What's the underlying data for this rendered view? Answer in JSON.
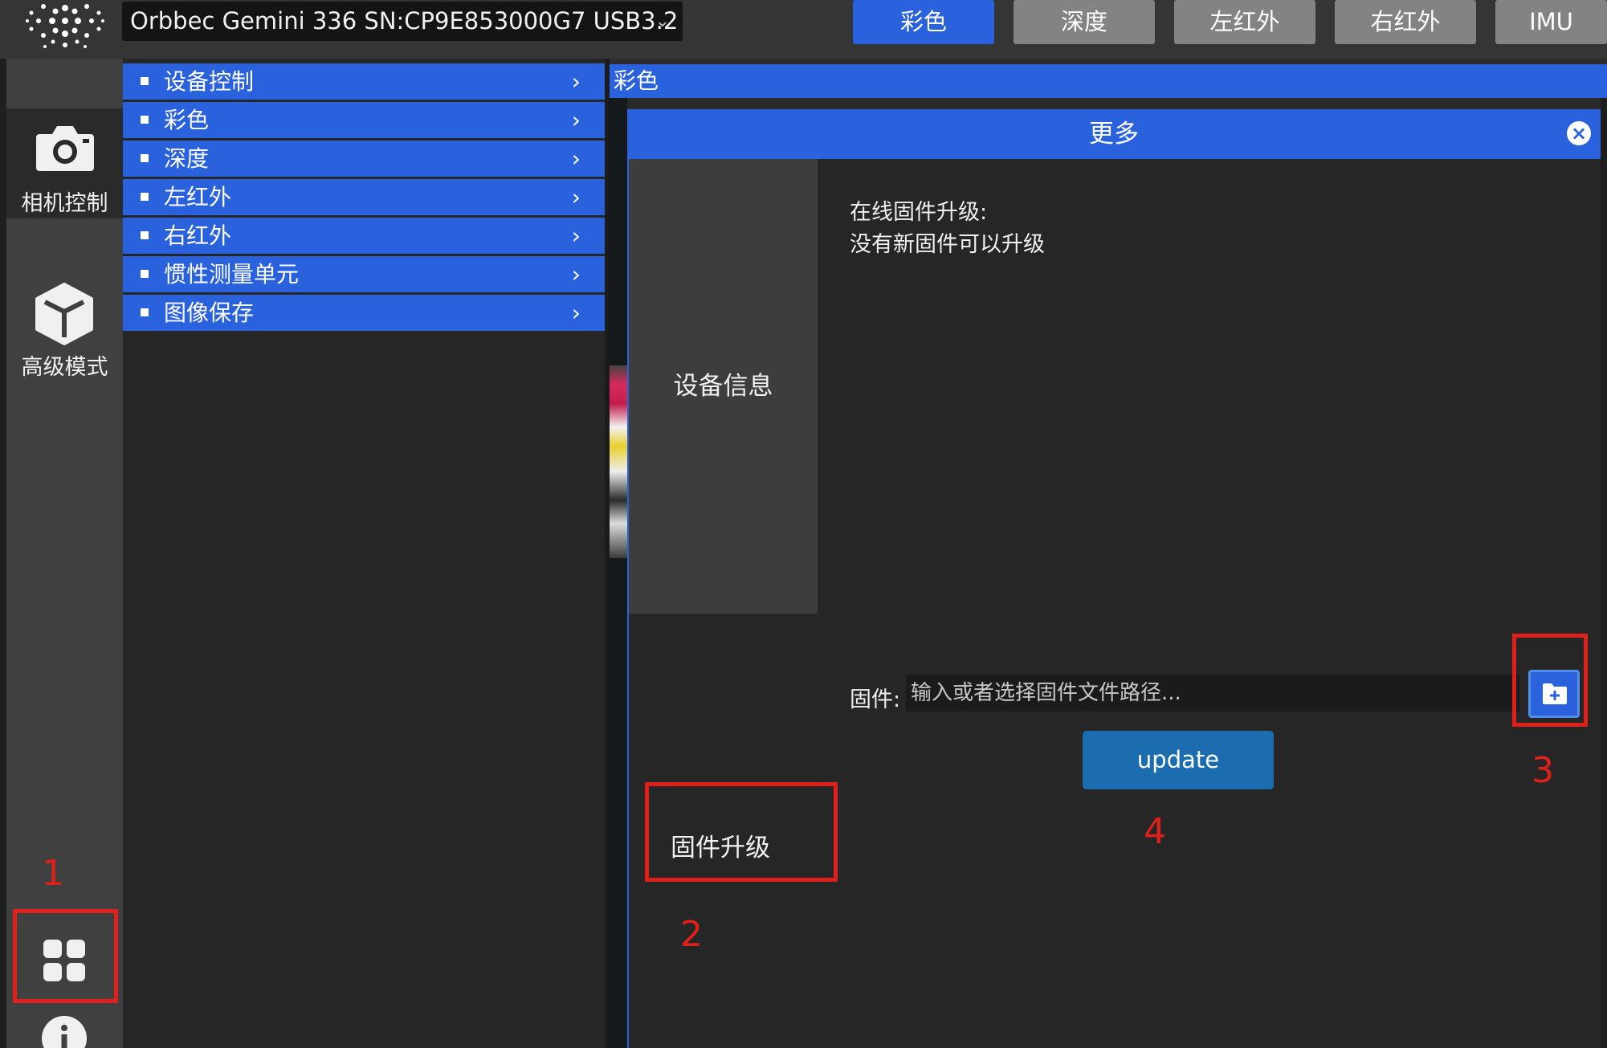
{
  "topbar": {
    "device": "Orbbec Gemini 336 SN:CP9E853000G7 USB3.2",
    "tabs": [
      {
        "label": "彩色",
        "active": true
      },
      {
        "label": "深度",
        "active": false
      },
      {
        "label": "左红外",
        "active": false
      },
      {
        "label": "右红外",
        "active": false
      },
      {
        "label": "IMU",
        "active": false
      }
    ]
  },
  "leftrail": {
    "camera_label": "相机控制",
    "advanced_label": "高级模式"
  },
  "control_list": [
    "设备控制",
    "彩色",
    "深度",
    "左红外",
    "右红外",
    "惯性测量单元",
    "图像保存"
  ],
  "content": {
    "header": "彩色"
  },
  "dialog": {
    "title": "更多",
    "tab_device_info": "设备信息",
    "tab_firmware": "固件升级",
    "online_title": "在线固件升级:",
    "online_status": "没有新固件可以升级",
    "fw_label": "固件:",
    "fw_placeholder": "输入或者选择固件文件路径...",
    "update_label": "update"
  },
  "annotations": [
    "1",
    "2",
    "3",
    "4"
  ],
  "colors": {
    "accent": "#2a62dd",
    "annotation": "#e0201b",
    "update_button": "#1c6cb0"
  }
}
